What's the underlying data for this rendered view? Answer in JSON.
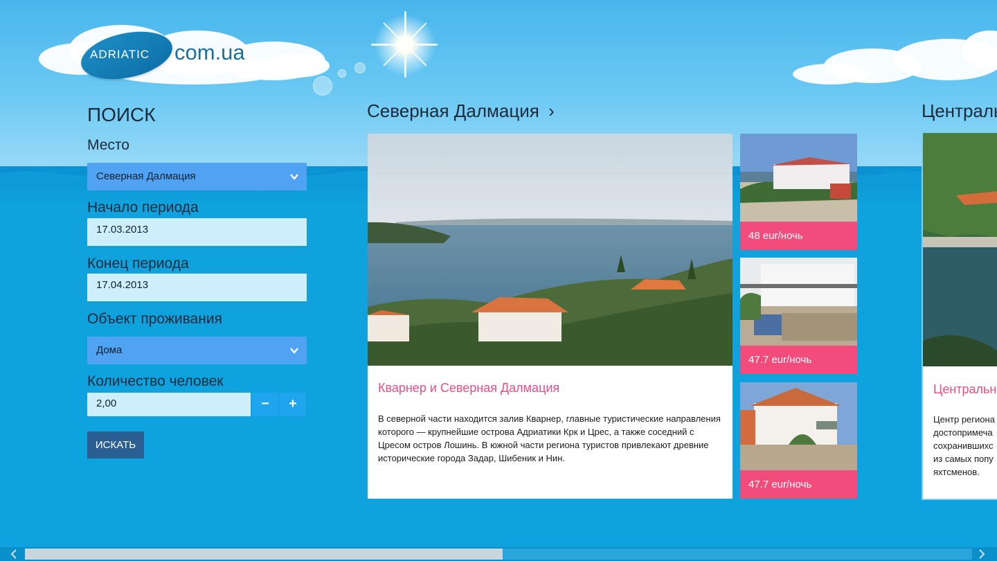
{
  "logo": {
    "brand": "ADRIATIC",
    "domain": "com.ua"
  },
  "search": {
    "title": "ПОИСК",
    "place_label": "Место",
    "place_value": "Северная Далмация",
    "start_label": "Начало периода",
    "start_value": "17.03.2013",
    "end_label": "Конец периода",
    "end_value": "17.04.2013",
    "accommodation_label": "Объект проживания",
    "accommodation_value": "Дома",
    "people_label": "Количество человек",
    "people_value": "2,00",
    "minus": "−",
    "plus": "+",
    "search_button": "ИСКАТЬ"
  },
  "groups": [
    {
      "title": "Северная Далмация",
      "chevron": "›",
      "hero_title": "Кварнер и Северная Далмация",
      "hero_desc": "В северной части находится залив Кварнер, главные туристические направления которого — крупнейшие острова Адриатики Крк и Црес, а также соседний с Цресом остров Лошинь. В южной части региона туристов привлекают древние исторические города Задар, Шибеник и Нин.",
      "tiles": [
        {
          "price": "48 eur/ночь"
        },
        {
          "price": "47.7 eur/ночь"
        },
        {
          "price": "47.7 eur/ночь"
        }
      ]
    },
    {
      "title": "Централь",
      "hero_title": "Центральн",
      "hero_desc_lines": [
        "Центр региона",
        "достопримеча",
        "сохранившихс",
        "из самых попу",
        "яхтсменов."
      ]
    }
  ],
  "colors": {
    "accent_pink": "#f24c7c",
    "select_blue": "#4fa3f2",
    "button_dark": "#2a5f94",
    "sea": "#0ea3de"
  },
  "icons": {
    "select_chevron": "chevron-down-icon",
    "group_chevron": "chevron-right-icon",
    "scroll_left": "arrow-left-icon",
    "scroll_right": "arrow-right-icon"
  }
}
